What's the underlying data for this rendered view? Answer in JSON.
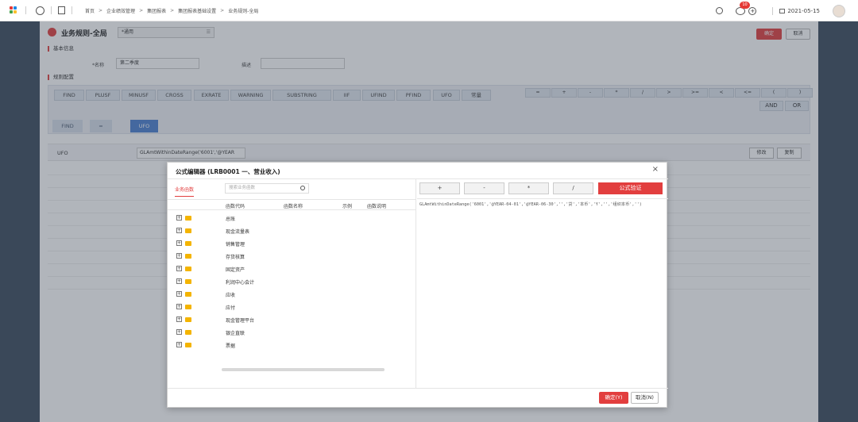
{
  "topbar": {
    "breadcrumb": [
      "首页",
      "企业绩效管理",
      "集团报表",
      "集团报表基础设置",
      "业务规则-全局"
    ],
    "breadcrumb_sep": ">",
    "notif_count": "10",
    "date": "2021-05-15"
  },
  "page": {
    "title": "业务规则-全局",
    "type_select": "*通用",
    "ok_label": "确定",
    "cancel_label": "取消"
  },
  "basic": {
    "section_title": "基本信息",
    "name_label": "*名称",
    "name_value": "第二季度",
    "desc_label": "描述",
    "desc_value": ""
  },
  "rules": {
    "section_title": "规则配置",
    "functions": [
      "FIND",
      "PLUSF",
      "MINUSF",
      "CROSS",
      "EXRATE",
      "WARNING",
      "SUBSTRING",
      "IIF",
      "UFIND",
      "PFIND",
      "UFO",
      "常量"
    ],
    "operators_row1": [
      "=",
      "+",
      "-",
      "*",
      "/",
      ">",
      ">=",
      "<",
      "<=",
      "(",
      ")"
    ],
    "operators_row2": [
      "AND",
      "OR"
    ],
    "chips": [
      "FIND",
      "=",
      "UFO"
    ],
    "ufo_key": "UFO",
    "ufo_value": "GLAmtWithinDateRange('6001','@YEAR",
    "edit_label": "修改",
    "copy_label": "复制"
  },
  "dialog": {
    "title": "公式编辑器 (LRB0001 一、营业收入)",
    "tab_label": "业务函数",
    "search_placeholder": "搜索业务函数",
    "columns": [
      "函数代码",
      "函数名称",
      "示例",
      "函数说明"
    ],
    "tree_items": [
      "总账",
      "现金流量表",
      "销售管理",
      "存货核算",
      "固定资产",
      "利润中心会计",
      "应收",
      "应付",
      "现金管理平台",
      "银企直联",
      "票据"
    ],
    "op_buttons": [
      "+",
      "-",
      "*",
      "/"
    ],
    "verify_label": "公式验证",
    "formula": "GLAmtWithinDateRange('6001','@YEAR-04-01','@YEAR-06-30','','贷','本币','Y','','组织本币','')",
    "ok_label": "确定(Y)",
    "cancel_label": "取消(N)"
  },
  "colors": {
    "accent": "#e23e3e",
    "chip_active": "#4a7fd0",
    "chip_idle": "#d5deea",
    "folder": "#f4b400"
  }
}
